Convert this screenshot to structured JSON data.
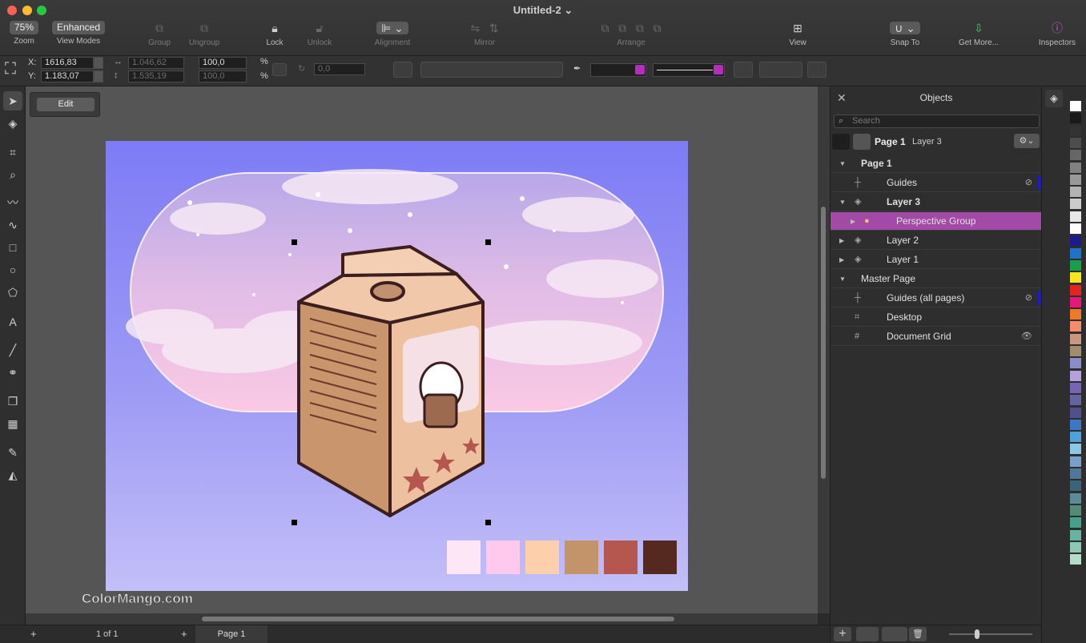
{
  "window": {
    "title": "Untitled-2 ⌄"
  },
  "toolbar": {
    "zoom": {
      "value": "75%",
      "label": "Zoom"
    },
    "view_modes": {
      "value": "Enhanced",
      "label": "View Modes"
    },
    "group": "Group",
    "ungroup": "Ungroup",
    "lock": "Lock",
    "unlock": "Unlock",
    "alignment": "Alignment",
    "mirror": "Mirror",
    "arrange": "Arrange",
    "view": "View",
    "snap_to": "Snap To",
    "get_more": "Get More...",
    "inspectors": "Inspectors"
  },
  "props": {
    "x_label": "X:",
    "x": "1616,83",
    "y_label": "Y:",
    "y": "1.183,07",
    "w": "1.046,62",
    "h": "1.535,19",
    "sx": "100,0",
    "sy": "100,0",
    "pct": "%",
    "pct2": "%",
    "angle": "0,0"
  },
  "edit_label": "Edit",
  "watermark": "ColorMango.com",
  "status": {
    "of": "1  of  1",
    "page_tab": "Page 1"
  },
  "panel": {
    "title": "Objects",
    "search_placeholder": "Search",
    "page": "Page 1",
    "layer": "Layer 3",
    "rows": [
      {
        "label": "Page 1",
        "bold": true
      },
      {
        "label": "Guides"
      },
      {
        "label": "Layer 3",
        "bold": true
      },
      {
        "label": "Perspective Group"
      },
      {
        "label": "Layer 2"
      },
      {
        "label": "Layer 1"
      },
      {
        "label": "Master Page"
      },
      {
        "label": "Guides (all pages)"
      },
      {
        "label": "Desktop"
      },
      {
        "label": "Document Grid"
      }
    ]
  },
  "colors": {
    "accent": "#a34aa8",
    "swatches": [
      "#fde6f6",
      "#fec9ec",
      "#fdcfab",
      "#c3936a",
      "#b5574f",
      "#552820"
    ]
  }
}
